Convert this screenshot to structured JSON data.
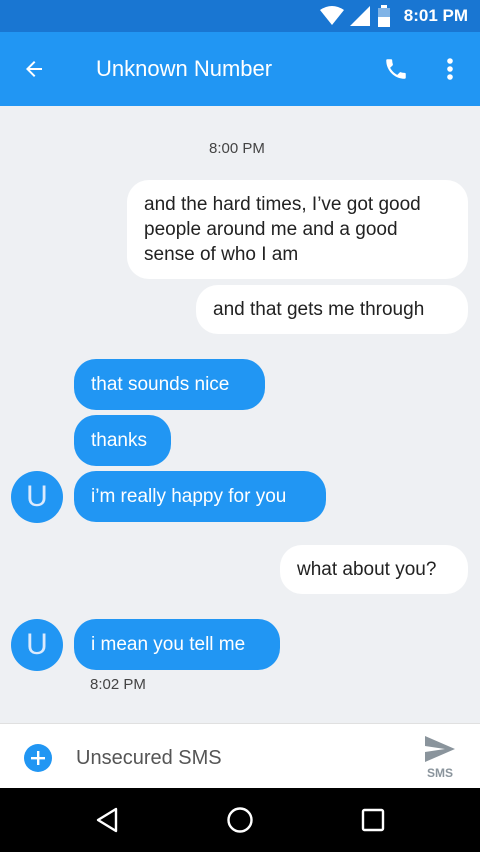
{
  "status_bar": {
    "time": "8:01 PM"
  },
  "header": {
    "title": "Unknown Number"
  },
  "conversation": {
    "timestamp_top": "8:00 PM",
    "messages": [
      {
        "direction": "outgoing",
        "text": "and the hard times, I’ve got good people around me and a good sense of who I am"
      },
      {
        "direction": "outgoing",
        "text": "and that gets me through"
      },
      {
        "direction": "incoming",
        "text": "that sounds nice"
      },
      {
        "direction": "incoming",
        "text": "thanks"
      },
      {
        "direction": "incoming",
        "text": "i’m really happy for you"
      },
      {
        "direction": "outgoing",
        "text": "what about you?"
      },
      {
        "direction": "incoming",
        "text": "i mean you tell me"
      }
    ],
    "avatar_letter": "U",
    "timestamp_bottom": "8:02 PM"
  },
  "compose": {
    "placeholder": "Unsecured SMS",
    "send_label": "SMS"
  },
  "colors": {
    "accent": "#2196f3",
    "status_bar": "#1976d2",
    "background": "#eef0f3"
  },
  "icons": [
    "wifi-icon",
    "signal-icon",
    "battery-icon",
    "back-arrow-icon",
    "phone-icon",
    "more-vert-icon",
    "add-icon",
    "send-icon",
    "nav-back-icon",
    "nav-home-icon",
    "nav-recents-icon"
  ]
}
